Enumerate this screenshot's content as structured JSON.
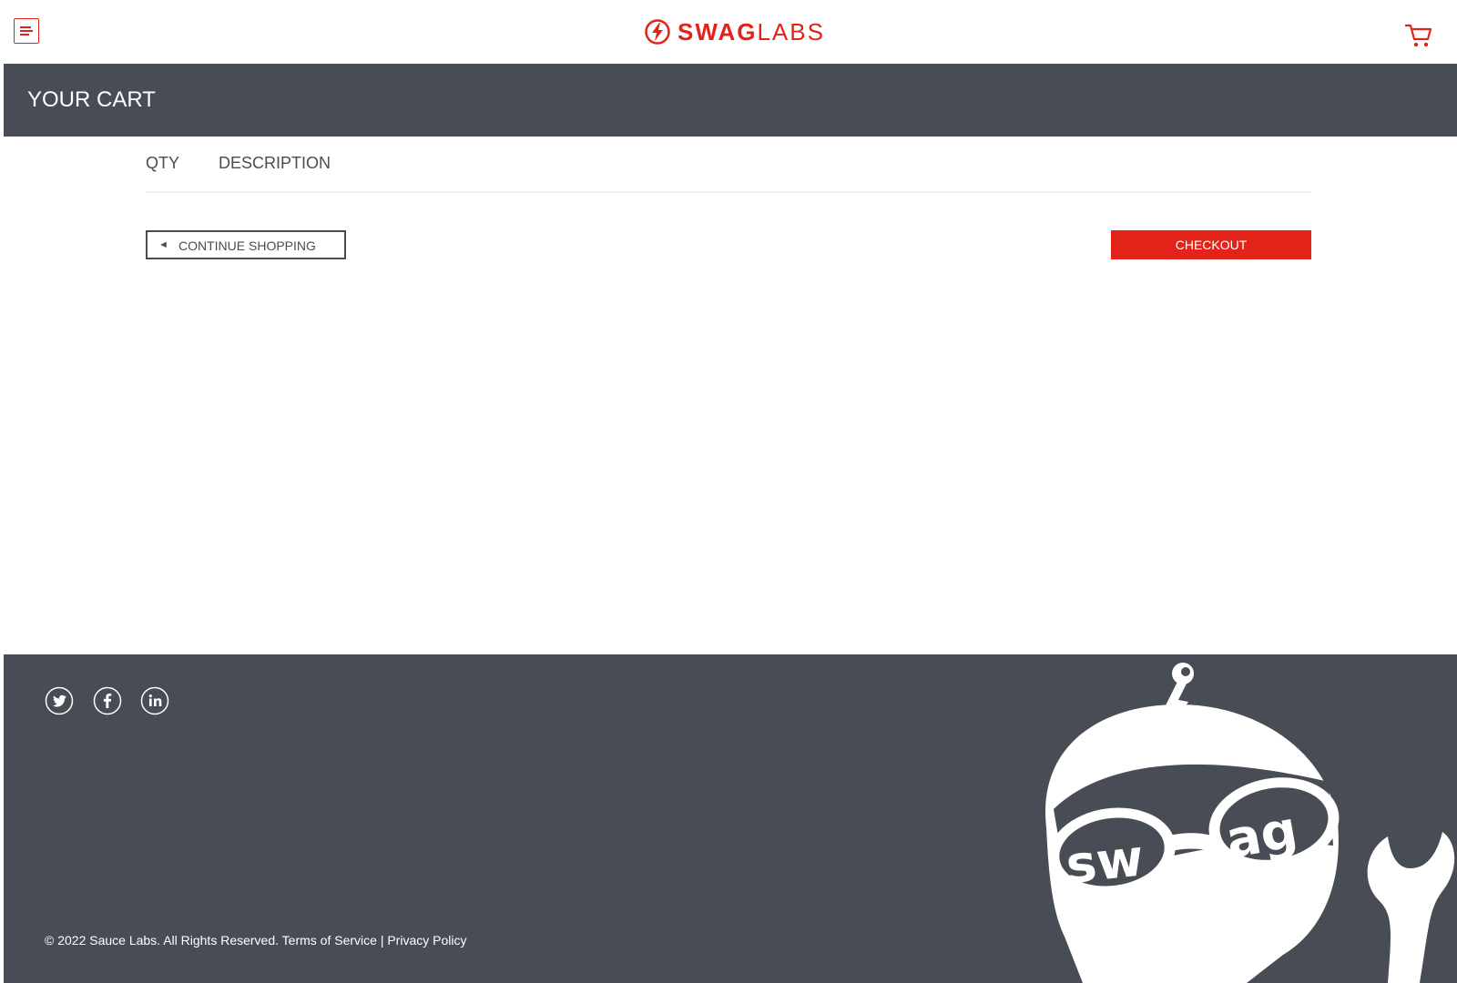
{
  "header": {
    "menu_icon": "hamburger-menu-icon",
    "logo": {
      "swag": "SWAG",
      "labs": "LABS"
    },
    "cart_icon": "shopping-cart-icon"
  },
  "subheader": {
    "title": "YOUR CART"
  },
  "cart_list": {
    "columns": {
      "qty": "QTY",
      "description": "DESCRIPTION"
    },
    "items": []
  },
  "actions": {
    "continue_arrow": "◄",
    "continue_label": "CONTINUE SHOPPING",
    "checkout_label": "CHECKOUT"
  },
  "footer": {
    "social": [
      {
        "name": "twitter",
        "icon": "twitter-icon"
      },
      {
        "name": "facebook",
        "icon": "facebook-icon"
      },
      {
        "name": "linkedin",
        "icon": "linkedin-icon"
      }
    ],
    "copyright": "© 2022 Sauce Labs. All Rights Reserved.",
    "terms_link": "Terms of Service",
    "separator": "|",
    "privacy_link": "Privacy Policy",
    "mascot": {
      "icon": "swag-robot-mascot-image",
      "lettering": "swag"
    }
  },
  "colors": {
    "accent": "#e2231a",
    "dark": "#484c55",
    "divider": "#ededed",
    "background": "#ffffff"
  }
}
